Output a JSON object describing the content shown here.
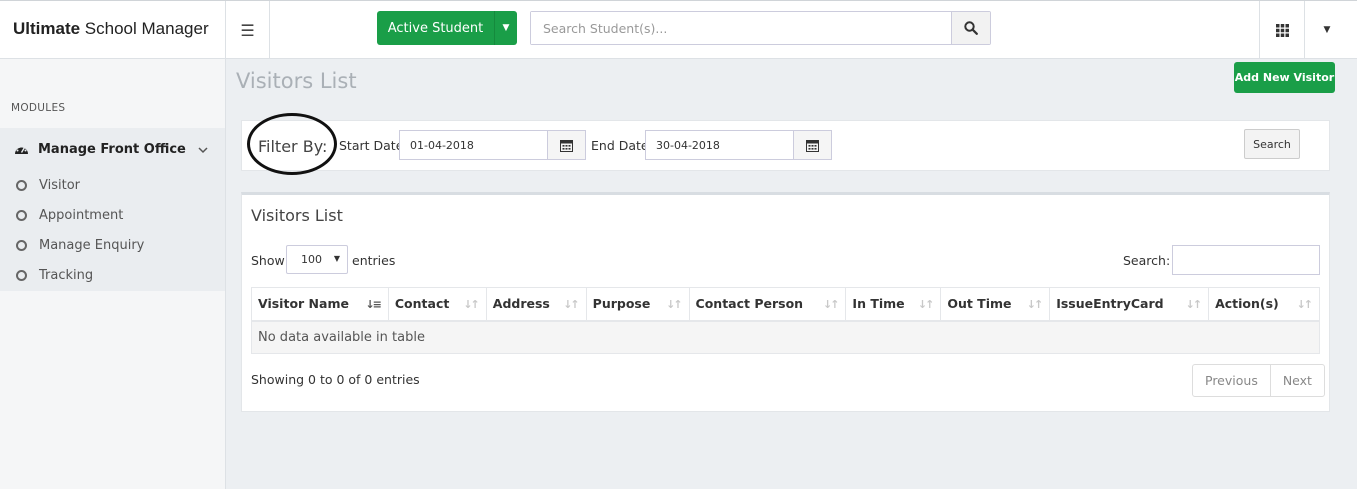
{
  "brand": {
    "bold": "Ultimate",
    "rest": " School Manager"
  },
  "header": {
    "active_student_label": "Active Student",
    "search_placeholder": "Search Student(s)..."
  },
  "sidebar": {
    "modules_label": "MODULES",
    "section_label": "Manage Front Office",
    "items": [
      {
        "label": "Visitor"
      },
      {
        "label": "Appointment"
      },
      {
        "label": "Manage Enquiry"
      },
      {
        "label": "Tracking"
      }
    ]
  },
  "page": {
    "title": "Visitors List",
    "add_button": "Add New Visitor"
  },
  "filter": {
    "filter_by": "Filter By:",
    "start_label": "Start Date:",
    "start_value": "01-04-2018",
    "end_label": "End Date:",
    "end_value": "30-04-2018",
    "search_button": "Search"
  },
  "list": {
    "title": "Visitors List",
    "show_label": "Show",
    "page_size": "100",
    "entries_label": "entries",
    "search_label": "Search:",
    "columns": [
      "Visitor Name",
      "Contact",
      "Address",
      "Purpose",
      "Contact Person",
      "In Time",
      "Out Time",
      "IssueEntryCard",
      "Action(s)"
    ],
    "empty_message": "No data available in table",
    "info": "Showing 0 to 0 of 0 entries",
    "prev_label": "Previous",
    "next_label": "Next"
  },
  "colors": {
    "accent_green": "#1a9e48",
    "title_gray": "#aab0b6"
  }
}
